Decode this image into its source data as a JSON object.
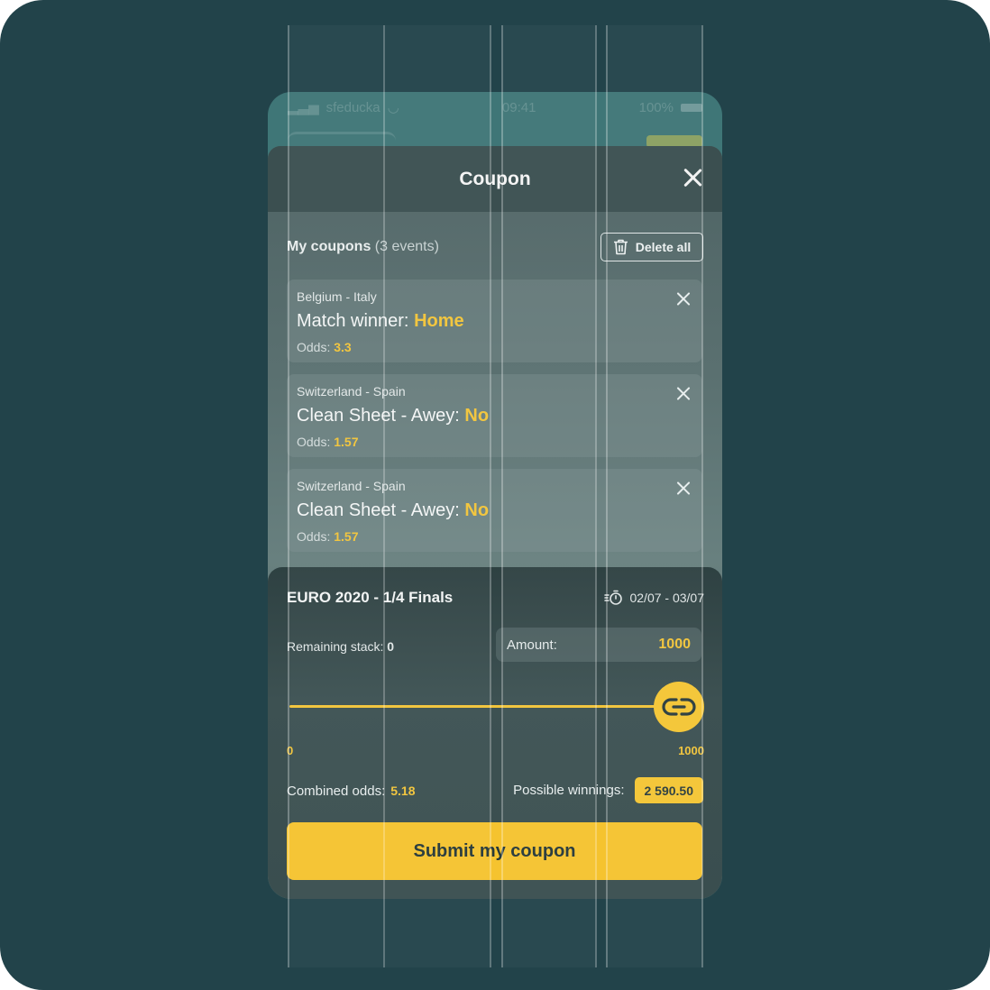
{
  "colors": {
    "background": "#22434a",
    "accent": "#f4c534",
    "sheet": "#5a7070"
  },
  "status_bar": {
    "carrier": "sfeducka",
    "time": "09:41",
    "battery": "100%"
  },
  "sheet": {
    "title": "Coupon",
    "close_icon": "close-icon",
    "my_coupons_label": "My coupons",
    "events_count": "(3 events)",
    "delete_all_label": "Delete all"
  },
  "bets": [
    {
      "match": "Belgium - Italy",
      "market": "Match winner: ",
      "selection": "Home",
      "odds_label": "Odds: ",
      "odds": "3.3"
    },
    {
      "match": "Switzerland - Spain",
      "market": "Clean Sheet - Awey: ",
      "selection": "No",
      "odds_label": "Odds: ",
      "odds": "1.57"
    },
    {
      "match": "Switzerland - Spain",
      "market": "Clean Sheet - Awey: ",
      "selection": "No",
      "odds_label": "Odds: ",
      "odds": "1.57"
    }
  ],
  "stake": {
    "tournament": "EURO 2020 - 1/4 Finals",
    "dates": "02/07 - 03/07",
    "remaining_label": "Remaining stack: ",
    "remaining_value": "0",
    "amount_label": "Amount:",
    "amount_value": "1000",
    "slider_min": "0",
    "slider_max": "1000",
    "slider_level": 1.0,
    "combined_label": "Combined odds:",
    "combined_value": "5.18",
    "winnings_label": "Possible winnings:",
    "winnings_value": "2 590.50",
    "submit_label": "Submit my coupon"
  }
}
